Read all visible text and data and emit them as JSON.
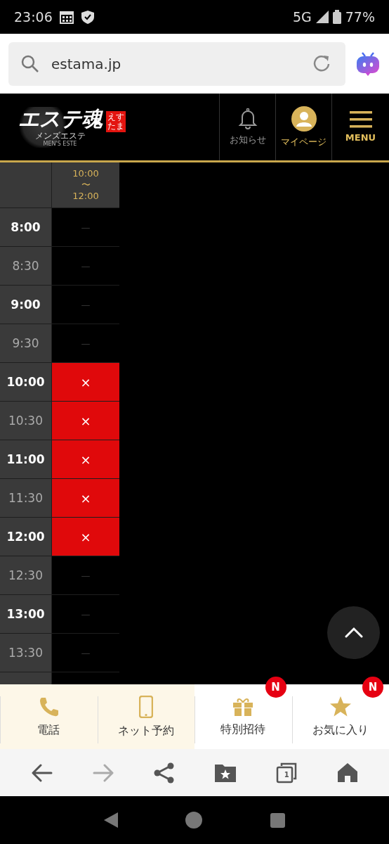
{
  "status_bar": {
    "time": "23:06",
    "network": "5G",
    "battery": "77%"
  },
  "address_bar": {
    "url": "estama.jp"
  },
  "site_header": {
    "logo": {
      "title": "エステ魂",
      "stamp": "えすたま",
      "subtitle": "メンズエステ",
      "tagline": "MEN'S ESTE"
    },
    "nav": [
      {
        "label": "お知らせ",
        "kind": "bell"
      },
      {
        "label": "マイページ",
        "kind": "avatar"
      },
      {
        "label": "MENU",
        "kind": "menu"
      }
    ]
  },
  "schedule": {
    "column_header": {
      "start": "10:00",
      "separator": "〜",
      "end": "12:00"
    },
    "rows": [
      {
        "time": "8:00",
        "kind": "hour",
        "booked": false,
        "mark": "—"
      },
      {
        "time": "8:30",
        "kind": "half-hour",
        "booked": false,
        "mark": "—"
      },
      {
        "time": "9:00",
        "kind": "hour",
        "booked": false,
        "mark": "—"
      },
      {
        "time": "9:30",
        "kind": "half-hour",
        "booked": false,
        "mark": "—"
      },
      {
        "time": "10:00",
        "kind": "hour",
        "booked": true,
        "mark": "×"
      },
      {
        "time": "10:30",
        "kind": "half-hour",
        "booked": true,
        "mark": "×"
      },
      {
        "time": "11:00",
        "kind": "hour",
        "booked": true,
        "mark": "×"
      },
      {
        "time": "11:30",
        "kind": "half-hour",
        "booked": true,
        "mark": "×"
      },
      {
        "time": "12:00",
        "kind": "hour",
        "booked": true,
        "mark": "×"
      },
      {
        "time": "12:30",
        "kind": "half-hour",
        "booked": false,
        "mark": "—"
      },
      {
        "time": "13:00",
        "kind": "hour",
        "booked": false,
        "mark": "—"
      },
      {
        "time": "13:30",
        "kind": "half-hour",
        "booked": false,
        "mark": "—"
      }
    ]
  },
  "bottom_nav": [
    {
      "label": "電話",
      "kind": "phone",
      "highlighted": true
    },
    {
      "label": "ネット予約",
      "kind": "smartphone",
      "highlighted": true
    },
    {
      "label": "特別招待",
      "kind": "gift",
      "highlighted": false,
      "badge": "N"
    },
    {
      "label": "お気に入り",
      "kind": "star",
      "highlighted": false,
      "badge": "N"
    }
  ],
  "browser_toolbar": [
    {
      "kind": "back",
      "disabled": false
    },
    {
      "kind": "forward",
      "disabled": true
    },
    {
      "kind": "share",
      "disabled": false
    },
    {
      "kind": "bookmarks",
      "disabled": false
    },
    {
      "kind": "tabs",
      "disabled": false,
      "count": "1"
    },
    {
      "kind": "home",
      "disabled": false
    }
  ]
}
